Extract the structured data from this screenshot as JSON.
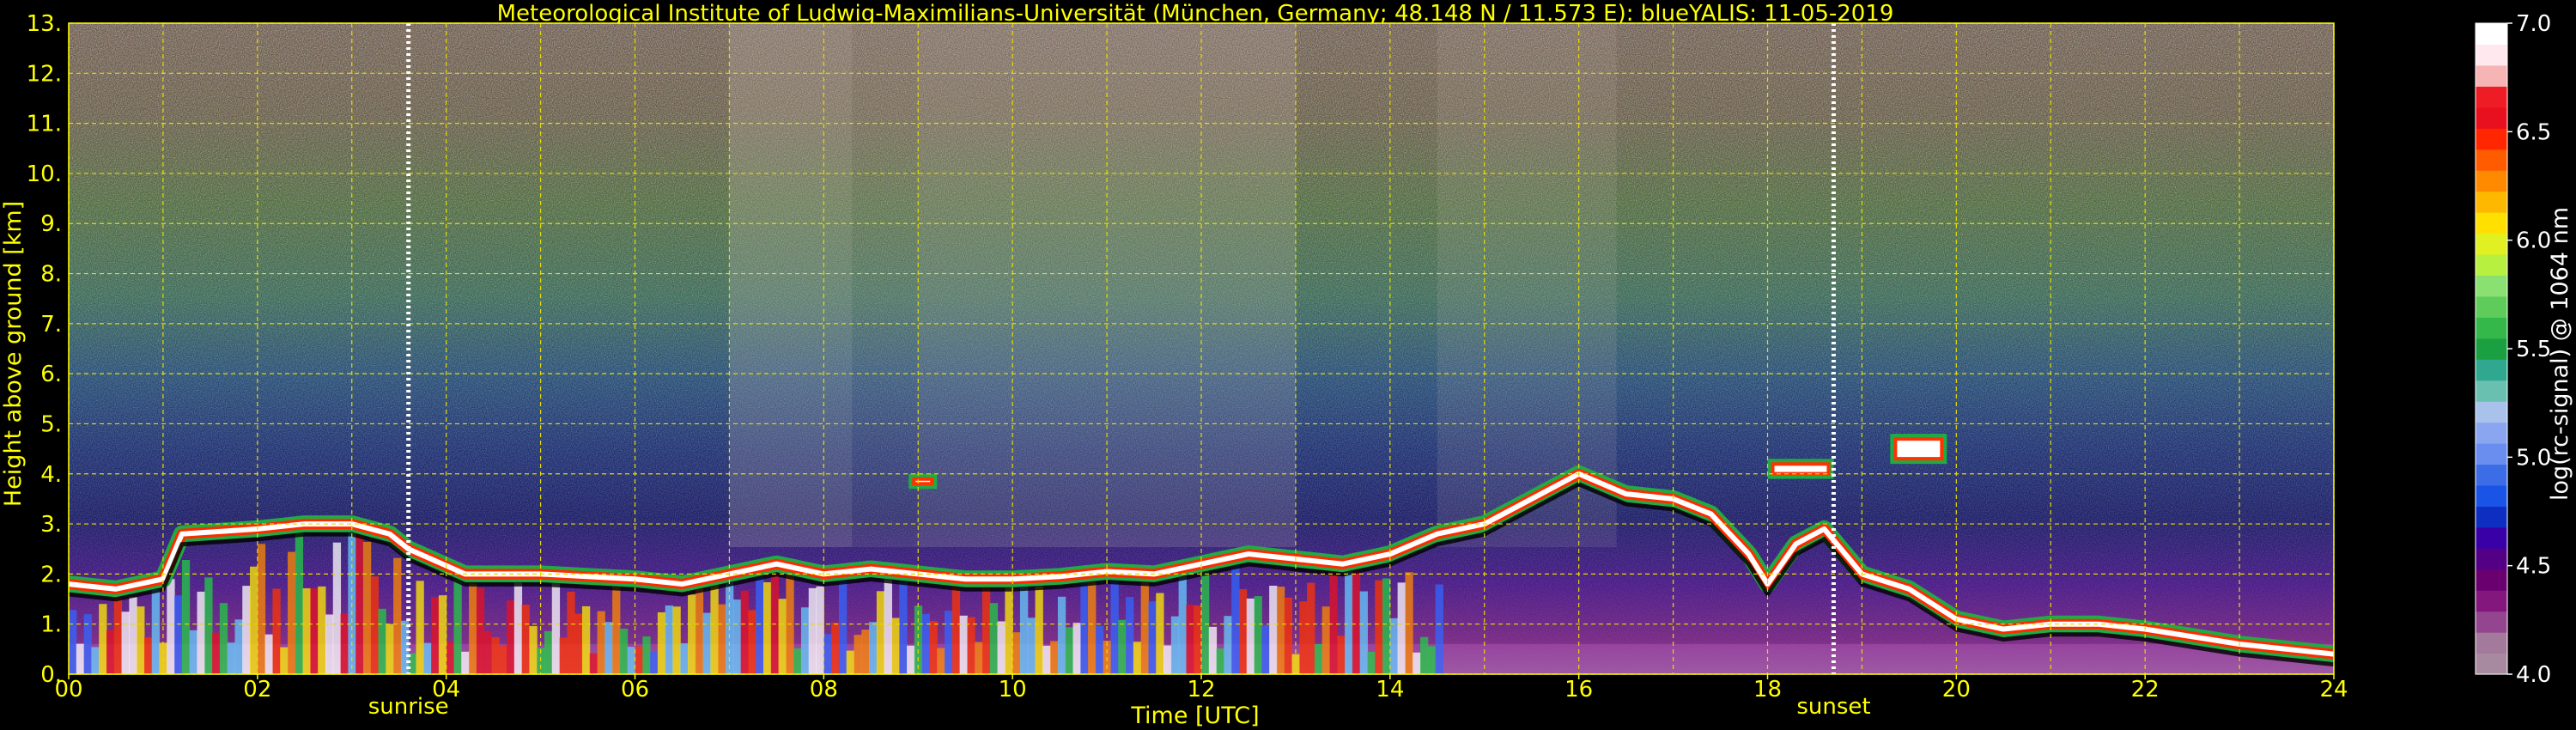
{
  "chart_data": {
    "type": "heatmap",
    "title": "Meteorological Institute of Ludwig-Maximilians-Universität (München, Germany; 48.148 N / 11.573 E):    blueYALIS: 11-05-2019",
    "xlabel": "Time [UTC]",
    "ylabel": "Height above ground [km]",
    "xlim": [
      0,
      24
    ],
    "ylim": [
      0,
      13
    ],
    "x_ticks": [
      "00",
      "02",
      "04",
      "06",
      "08",
      "10",
      "12",
      "14",
      "16",
      "18",
      "20",
      "22",
      "24"
    ],
    "y_ticks": [
      "0.",
      "1.",
      "2.",
      "3.",
      "4.",
      "5.",
      "6.",
      "7.",
      "8.",
      "9.",
      "10.",
      "11.",
      "12.",
      "13."
    ],
    "grid": true,
    "colorbar": {
      "label": "log(rc-signal) @ 1064 nm",
      "range": [
        4.0,
        7.0
      ],
      "ticks": [
        "4.0",
        "4.5",
        "5.0",
        "5.5",
        "6.0",
        "6.5",
        "7.0"
      ],
      "colors": [
        "#a88aa0",
        "#a47a9c",
        "#94458f",
        "#84177e",
        "#6a0070",
        "#540086",
        "#3a00a8",
        "#0d2ec0",
        "#1a54e6",
        "#3c6ce6",
        "#6a8ef0",
        "#8aa6f0",
        "#a8c2ec",
        "#6ac0b0",
        "#30a890",
        "#1aa040",
        "#34b84a",
        "#5ecc5a",
        "#8ae070",
        "#b8f040",
        "#e0f020",
        "#ffe000",
        "#ffb800",
        "#ff8a00",
        "#ff5c00",
        "#ff2600",
        "#e8101e",
        "#ee1c24",
        "#f7b4b4",
        "#ffe8ee",
        "#ffffff"
      ]
    },
    "annotations": [
      {
        "text": "sunrise",
        "x": 3.6
      },
      {
        "text": "sunset",
        "x": 18.7
      }
    ],
    "cloud_layer": {
      "description_of": "approximate height (km) of the strongest backscatter layer vs time (UTC)",
      "points": [
        [
          0.0,
          1.8
        ],
        [
          0.5,
          1.7
        ],
        [
          1.0,
          1.9
        ],
        [
          1.2,
          2.8
        ],
        [
          2.0,
          2.9
        ],
        [
          2.5,
          3.0
        ],
        [
          3.0,
          3.0
        ],
        [
          3.4,
          2.8
        ],
        [
          3.6,
          2.5
        ],
        [
          4.2,
          2.0
        ],
        [
          5.0,
          2.0
        ],
        [
          6.0,
          1.9
        ],
        [
          6.5,
          1.8
        ],
        [
          7.0,
          2.0
        ],
        [
          7.5,
          2.2
        ],
        [
          8.0,
          2.0
        ],
        [
          8.5,
          2.1
        ],
        [
          9.0,
          2.0
        ],
        [
          9.5,
          1.9
        ],
        [
          10.0,
          1.9
        ],
        [
          10.5,
          1.95
        ],
        [
          11.0,
          2.05
        ],
        [
          11.5,
          2.0
        ],
        [
          12.0,
          2.2
        ],
        [
          12.5,
          2.4
        ],
        [
          13.0,
          2.3
        ],
        [
          13.5,
          2.2
        ],
        [
          14.0,
          2.4
        ],
        [
          14.5,
          2.8
        ],
        [
          15.0,
          3.0
        ],
        [
          15.5,
          3.5
        ],
        [
          16.0,
          4.0
        ],
        [
          16.5,
          3.6
        ],
        [
          17.0,
          3.5
        ],
        [
          17.4,
          3.2
        ],
        [
          17.8,
          2.4
        ],
        [
          18.0,
          1.8
        ],
        [
          18.3,
          2.6
        ],
        [
          18.6,
          2.9
        ],
        [
          19.0,
          2.0
        ],
        [
          19.5,
          1.7
        ],
        [
          20.0,
          1.1
        ],
        [
          20.5,
          0.9
        ],
        [
          21.0,
          1.0
        ],
        [
          21.5,
          1.0
        ],
        [
          22.0,
          0.9
        ],
        [
          23.0,
          0.6
        ],
        [
          24.0,
          0.4
        ]
      ]
    },
    "elevated_layers": [
      {
        "x": [
          8.9,
          9.2
        ],
        "y": [
          3.7,
          4.0
        ]
      },
      {
        "x": [
          18.0,
          18.7
        ],
        "y": [
          3.9,
          4.3
        ]
      },
      {
        "x": [
          19.3,
          19.9
        ],
        "y": [
          4.2,
          4.8
        ]
      }
    ]
  }
}
